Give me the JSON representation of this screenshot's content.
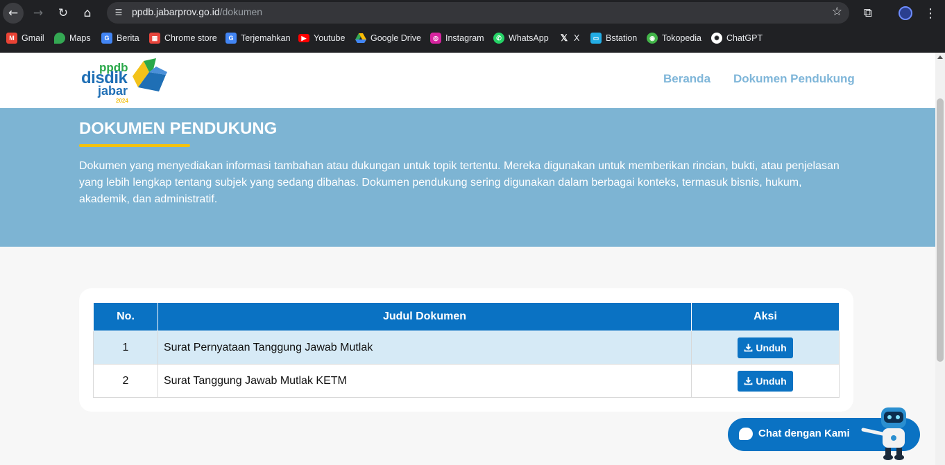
{
  "browser": {
    "url_host": "ppdb.jabarprov.go.id",
    "url_path": "/dokumen",
    "bookmarks": [
      {
        "label": "Gmail",
        "icon": "gmail-icon",
        "color": "#ea4335"
      },
      {
        "label": "Maps",
        "icon": "maps-icon",
        "color": "#34a853"
      },
      {
        "label": "Berita",
        "icon": "news-icon",
        "color": "#4285f4"
      },
      {
        "label": "Chrome store",
        "icon": "chrome-store-icon",
        "color": "#e8453c"
      },
      {
        "label": "Terjemahkan",
        "icon": "translate-icon",
        "color": "#4285f4"
      },
      {
        "label": "Youtube",
        "icon": "youtube-icon",
        "color": "#ff0000"
      },
      {
        "label": "Google Drive",
        "icon": "drive-icon",
        "color": "#fbbc04"
      },
      {
        "label": "Instagram",
        "icon": "instagram-icon",
        "color": "#d6249f"
      },
      {
        "label": "WhatsApp",
        "icon": "whatsapp-icon",
        "color": "#25d366"
      },
      {
        "label": "X",
        "icon": "x-icon",
        "color": "#ffffff"
      },
      {
        "label": "Bstation",
        "icon": "bstation-icon",
        "color": "#23ade5"
      },
      {
        "label": "Tokopedia",
        "icon": "tokopedia-icon",
        "color": "#42b549"
      },
      {
        "label": "ChatGPT",
        "icon": "chatgpt-icon",
        "color": "#ffffff"
      }
    ]
  },
  "logo": {
    "line1": "ppdb",
    "line2": "disdik",
    "line3": "jabar",
    "year": "2024"
  },
  "nav": {
    "home": "Beranda",
    "docs": "Dokumen Pendukung"
  },
  "hero": {
    "title": "DOKUMEN PENDUKUNG",
    "description": "Dokumen yang menyediakan informasi tambahan atau dukungan untuk topik tertentu. Mereka digunakan untuk memberikan rincian, bukti, atau penjelasan yang lebih lengkap tentang subjek yang sedang dibahas. Dokumen pendukung sering digunakan dalam berbagai konteks, termasuk bisnis, hukum, akademik, dan administratif."
  },
  "table": {
    "headers": {
      "no": "No.",
      "title": "Judul Dokumen",
      "action": "Aksi"
    },
    "rows": [
      {
        "no": "1",
        "title": "Surat Pernyataan Tanggung Jawab Mutlak",
        "action": "Unduh"
      },
      {
        "no": "2",
        "title": "Surat Tanggung Jawab Mutlak KETM",
        "action": "Unduh"
      }
    ]
  },
  "chat": {
    "label": "Chat dengan Kami"
  },
  "colors": {
    "primary": "#0a72c3",
    "hero": "#7db4d3",
    "accent": "#f4c20d",
    "nav": "#7fb6d9"
  }
}
